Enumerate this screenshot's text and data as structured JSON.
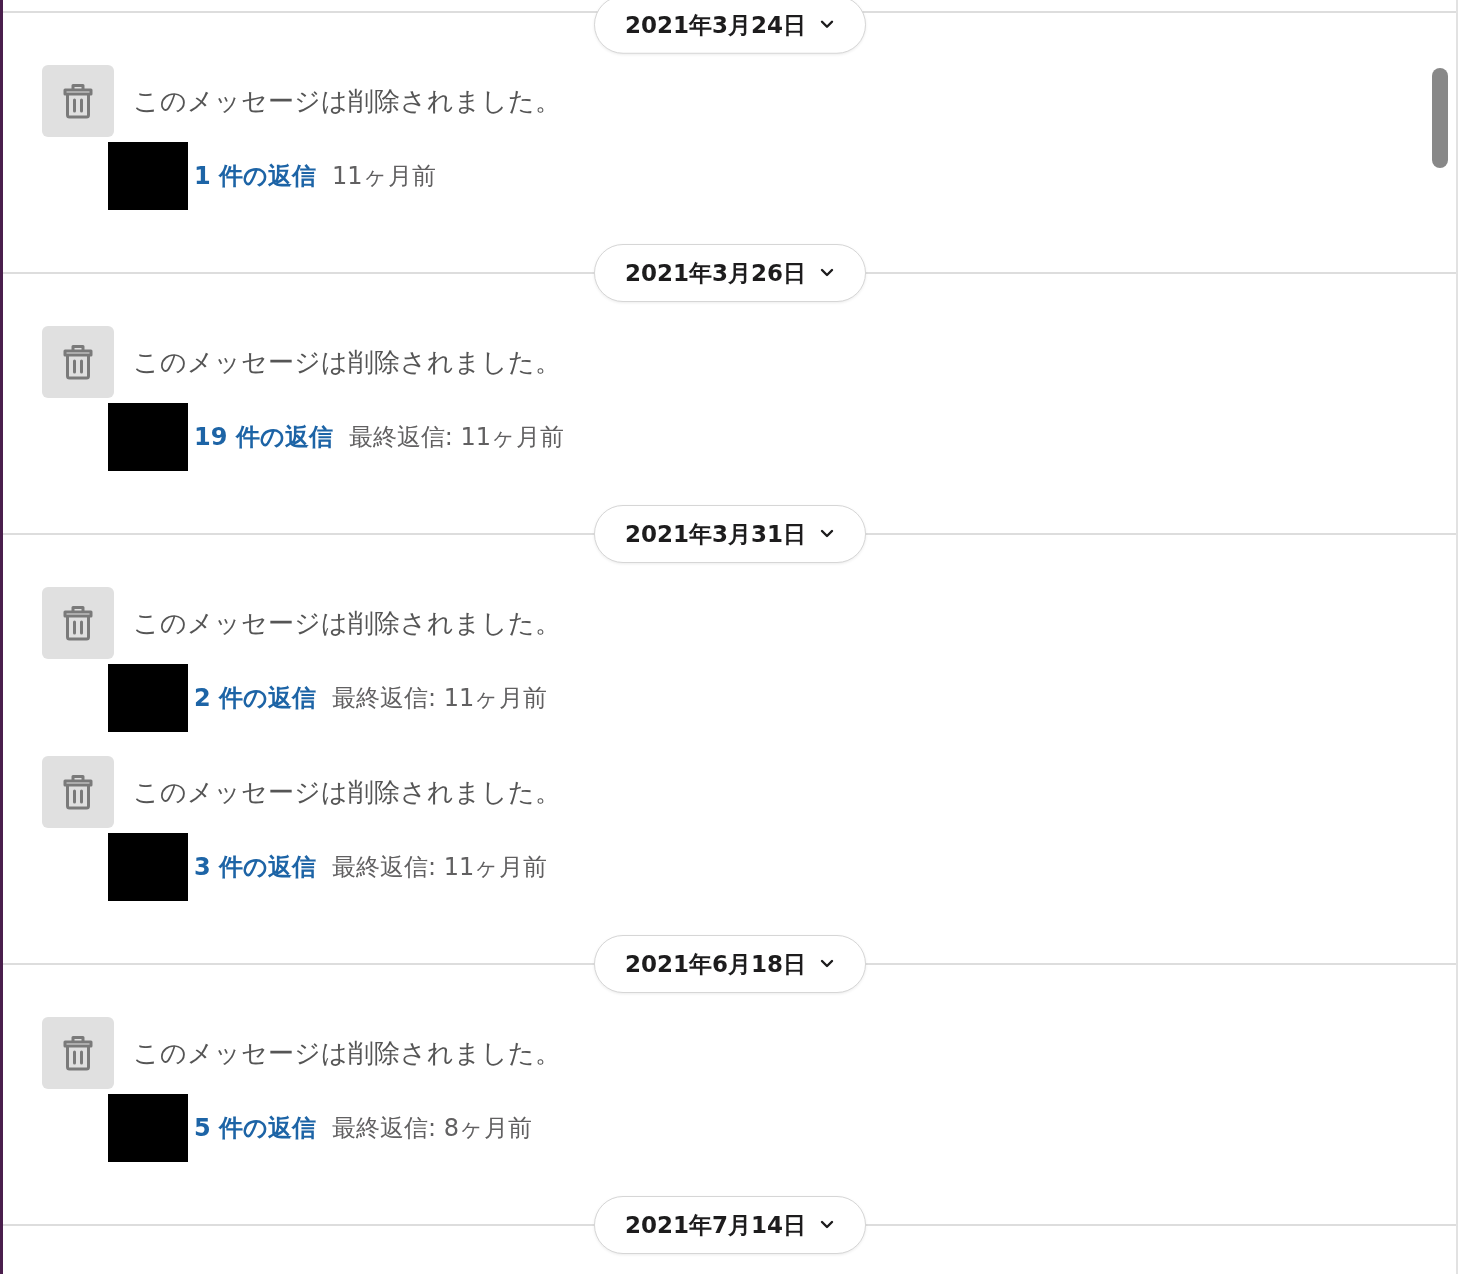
{
  "sections": [
    {
      "date": "2021年3月24日",
      "messages": [
        {
          "text": "このメッセージは削除されました。",
          "replies": "1 件の返信",
          "last_reply": "11ヶ月前"
        }
      ]
    },
    {
      "date": "2021年3月26日",
      "messages": [
        {
          "text": "このメッセージは削除されました。",
          "replies": "19 件の返信",
          "last_reply": "最終返信: 11ヶ月前"
        }
      ]
    },
    {
      "date": "2021年3月31日",
      "messages": [
        {
          "text": "このメッセージは削除されました。",
          "replies": "2 件の返信",
          "last_reply": "最終返信: 11ヶ月前"
        },
        {
          "text": "このメッセージは削除されました。",
          "replies": "3 件の返信",
          "last_reply": "最終返信: 11ヶ月前"
        }
      ]
    },
    {
      "date": "2021年6月18日",
      "messages": [
        {
          "text": "このメッセージは削除されました。",
          "replies": "5 件の返信",
          "last_reply": "最終返信: 8ヶ月前"
        }
      ]
    },
    {
      "date": "2021年7月14日"
    }
  ]
}
